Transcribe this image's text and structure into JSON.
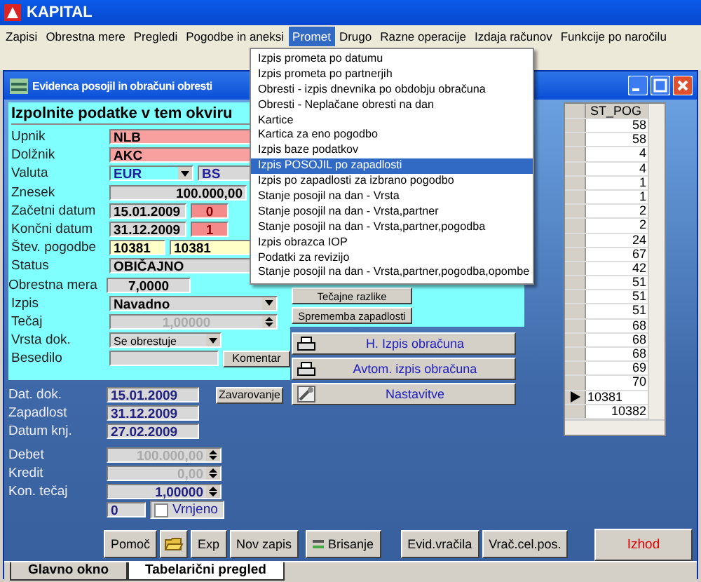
{
  "app_title": "KAPITAL",
  "menu": [
    {
      "label": "Zapisi",
      "selected": false
    },
    {
      "label": "Obrestna mere",
      "selected": false
    },
    {
      "label": "Pregledi",
      "selected": false
    },
    {
      "label": "Pogodbe in aneksi",
      "selected": false
    },
    {
      "label": "Promet",
      "selected": true
    },
    {
      "label": "Drugo",
      "selected": false
    },
    {
      "label": "Razne operacije",
      "selected": false
    },
    {
      "label": "Izdaja računov",
      "selected": false
    },
    {
      "label": "Funkcije po naročilu",
      "selected": false
    }
  ],
  "dropdown": [
    {
      "label": "Izpis prometa po datumu",
      "selected": false
    },
    {
      "label": "Izpis prometa po partnerjih",
      "selected": false
    },
    {
      "label": "Obresti - izpis dnevnika po obdobju obračuna",
      "selected": false
    },
    {
      "label": "Obresti - Neplačane obresti na dan",
      "selected": false
    },
    {
      "label": "Kartice",
      "selected": false
    },
    {
      "label": "Kartica za eno pogodbo",
      "selected": false
    },
    {
      "label": "Izpis baze podatkov",
      "selected": false
    },
    {
      "label": "Izpis POSOJIL po zapadlosti",
      "selected": true
    },
    {
      "label": "Izpis po zapadlosti za izbrano pogodbo",
      "selected": false
    },
    {
      "label": "Stanje posojil na dan - Vrsta",
      "selected": false
    },
    {
      "label": "Stanje posojil na dan - Vrsta,partner",
      "selected": false
    },
    {
      "label": "Stanje posojil na dan - Vrsta,partner,pogodba",
      "selected": false
    },
    {
      "label": "Izpis obrazca IOP",
      "selected": false
    },
    {
      "label": "Podatki za revizijo",
      "selected": false
    },
    {
      "label": "Stanje posojil na dan - Vrsta,partner,pogodba,opombe",
      "selected": false
    }
  ],
  "window": {
    "title": "Evidenca posojil in obračuni obresti"
  },
  "form": {
    "heading": "Izpolnite podatke v tem okviru",
    "upnik": {
      "label": "Upnik",
      "value": "NLB"
    },
    "dolznik": {
      "label": "Dolžnik",
      "value": "AKC"
    },
    "valuta": {
      "label": "Valuta",
      "value": "EUR",
      "value_2": "BS"
    },
    "znesek": {
      "label": "Znesek",
      "value": "100.000,00"
    },
    "zacetni_datum": {
      "label": "Začetni datum",
      "value": "15.01.2009",
      "days": "0"
    },
    "koncni_datum": {
      "label": "Končni datum",
      "value": "31.12.2009",
      "days": "1"
    },
    "stev_pogodbe": {
      "label": "Štev. pogodbe",
      "value": "10381",
      "value_2": "10381"
    },
    "status": {
      "label": "Status",
      "value": "OBIČAJNO"
    },
    "obrestna_mera": {
      "label": "Obrestna mera",
      "value": "7,0000"
    },
    "izpis": {
      "label": "Izpis",
      "value": "Navadno"
    },
    "tecaj": {
      "label": "Tečaj",
      "value": "1,00000",
      "disabled": true
    },
    "vrsta_dok": {
      "label": "Vrsta dok.",
      "value": "Se obrestuje"
    },
    "besedilo": {
      "label": "Besedilo"
    },
    "komentar_button": "Komentar",
    "zavarovanje_button": "Zavarovanje",
    "dat_dok": {
      "label": "Dat. dok.",
      "value": "15.01.2009"
    },
    "zapadlost": {
      "label": "Zapadlost",
      "value": "31.12.2009"
    },
    "datum_knj": {
      "label": "Datum knj.",
      "value": "27.02.2009"
    },
    "debet": {
      "label": "Debet",
      "value": "100.000,00",
      "disabled": true
    },
    "kredit": {
      "label": "Kredit",
      "value": "0,00",
      "disabled": true
    },
    "kon_tecaj": {
      "label": "Kon. tečaj",
      "value": "1,00000",
      "disabled": false
    },
    "counter": "0",
    "vrnjeno": {
      "label": "Vrnjeno",
      "checked": false
    }
  },
  "side_buttons": [
    "Tečajne razlike",
    "Sprememba zapadlosti"
  ],
  "print_buttons": [
    {
      "label": "H. Izpis obračuna",
      "kind": "printer"
    },
    {
      "label": "Avtom. izpis obračuna",
      "kind": "printer"
    },
    {
      "label": "Nastavitve",
      "kind": "tools"
    }
  ],
  "grid": {
    "column": "ST_POG",
    "rows": [
      {
        "value": "58",
        "selected": false
      },
      {
        "value": "58",
        "selected": false
      },
      {
        "value": "4",
        "selected": false
      },
      {
        "value": "4",
        "selected": false
      },
      {
        "value": "1",
        "selected": false
      },
      {
        "value": "1",
        "selected": false
      },
      {
        "value": "2",
        "selected": false
      },
      {
        "value": "2",
        "selected": false
      },
      {
        "value": "24",
        "selected": false
      },
      {
        "value": "67",
        "selected": false
      },
      {
        "value": "42",
        "selected": false
      },
      {
        "value": "51",
        "selected": false
      },
      {
        "value": "51",
        "selected": false
      },
      {
        "value": "51",
        "selected": false
      },
      {
        "value": "68",
        "selected": false
      },
      {
        "value": "68",
        "selected": false
      },
      {
        "value": "68",
        "selected": false
      },
      {
        "value": "69",
        "selected": false
      },
      {
        "value": "70",
        "selected": false
      },
      {
        "value": "10381",
        "selected": true
      },
      {
        "value": "10382",
        "selected": false
      }
    ]
  },
  "bottom_buttons": [
    {
      "kind": "text",
      "label": "Pomoč"
    },
    {
      "kind": "folder"
    },
    {
      "kind": "text",
      "label": "Exp"
    },
    {
      "kind": "text",
      "label": "Nov zapis"
    },
    {
      "kind": "delete",
      "label": "Brisanje"
    },
    {
      "kind": "text",
      "label": "Evid.vračila"
    },
    {
      "kind": "text",
      "label": "Vrač.cel.pos."
    }
  ],
  "exit_button": "Izhod",
  "tabs": [
    {
      "label": "Glavno okno",
      "selected": false
    },
    {
      "label": "Tabelarični pregled",
      "selected": true
    }
  ]
}
